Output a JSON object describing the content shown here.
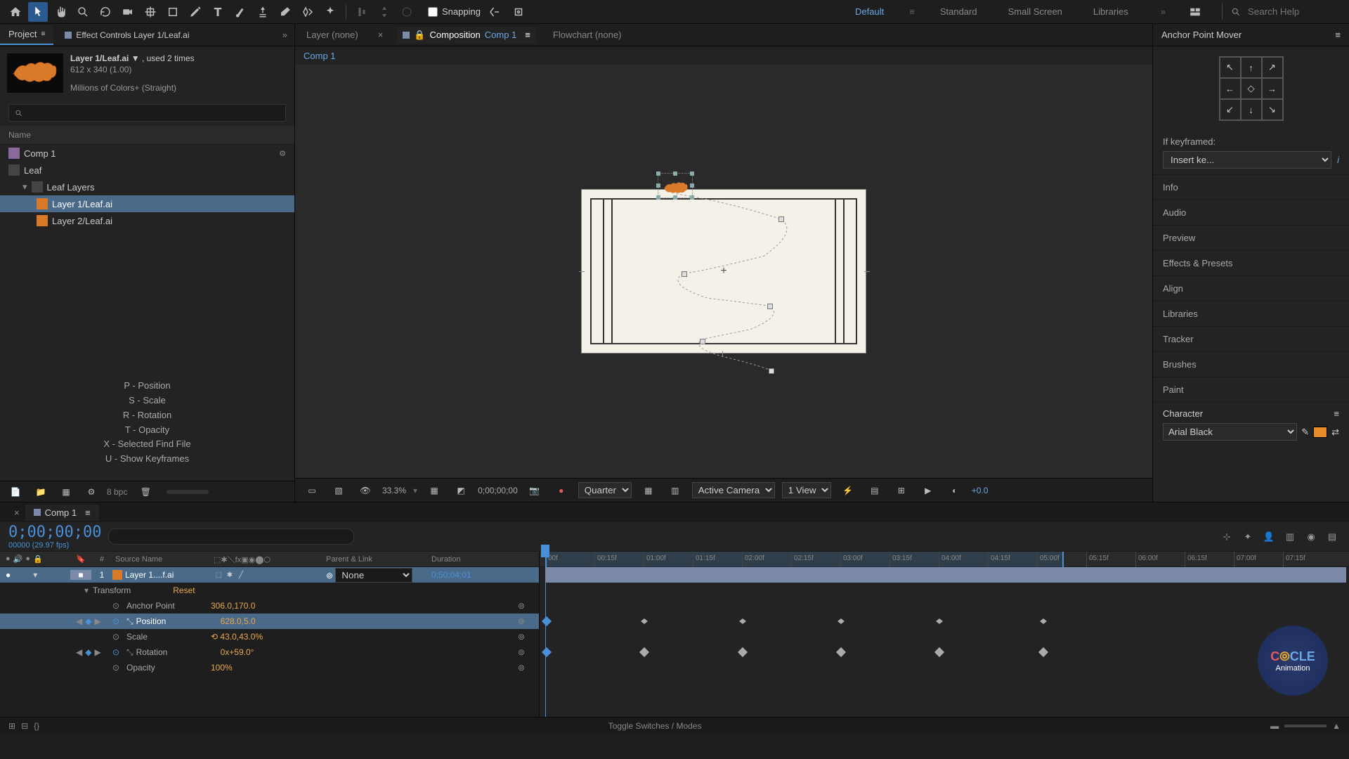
{
  "toolbar": {
    "snapping_label": "Snapping",
    "workspaces": [
      "Default",
      "Standard",
      "Small Screen",
      "Libraries"
    ],
    "active_workspace": "Default",
    "search_placeholder": "Search Help"
  },
  "project_panel": {
    "tab_project": "Project",
    "tab_effect_controls": "Effect Controls Layer 1/Leaf.ai",
    "selected_item": {
      "name": "Layer 1/Leaf.ai",
      "usage": ", used 2 times",
      "dimensions": "612 x 340 (1.00)",
      "colors": "Millions of Colors+ (Straight)"
    },
    "name_col": "Name",
    "items": {
      "comp": "Comp 1",
      "leaf": "Leaf",
      "folder": "Leaf Layers",
      "layer1": "Layer 1/Leaf.ai",
      "layer2": "Layer 2/Leaf.ai"
    },
    "hints": [
      "P - Position",
      "S - Scale",
      "R - Rotation",
      "T - Opacity",
      "X - Selected Find File",
      "U - Show Keyframes"
    ],
    "bpc": "8 bpc"
  },
  "comp_viewer": {
    "tab_layer": "Layer (none)",
    "tab_composition_prefix": "Composition ",
    "tab_composition_name": "Comp 1",
    "tab_flowchart": "Flowchart (none)",
    "breadcrumb": "Comp 1",
    "bottombar": {
      "zoom": "33.3%",
      "timecode": "0;00;00;00",
      "resolution": "Quarter",
      "camera": "Active Camera",
      "view": "1 View",
      "exposure": "+0.0"
    }
  },
  "right_panel": {
    "title": "Anchor Point Mover",
    "if_keyframed": "If keyframed:",
    "kf_option": "Insert ke...",
    "sections": [
      "Info",
      "Audio",
      "Preview",
      "Effects & Presets",
      "Align",
      "Libraries",
      "Tracker",
      "Brushes",
      "Paint"
    ],
    "character": "Character",
    "font": "Arial Black"
  },
  "timeline": {
    "tab": "Comp 1",
    "timecode": "0;00;00;00",
    "fps_hint": "00000 (29.97 fps)",
    "columns": {
      "source_name": "Source Name",
      "parent": "Parent & Link",
      "duration": "Duration"
    },
    "layer": {
      "num": "1",
      "name": "Layer 1....f.ai",
      "parent": "None",
      "duration": "0;50;04;01"
    },
    "transform_label": "Transform",
    "reset": "Reset",
    "props": {
      "anchor_point": {
        "name": "Anchor Point",
        "value": "306.0,170.0"
      },
      "position": {
        "name": "Position",
        "value": "628.0,5.0"
      },
      "scale": {
        "name": "Scale",
        "value": "43.0,43.0%"
      },
      "rotation": {
        "name": "Rotation",
        "value": "0x+59.0°"
      },
      "opacity": {
        "name": "Opacity",
        "value": "100%"
      }
    },
    "ruler": [
      "00f",
      "00:15f",
      "01:00f",
      "01:15f",
      "02:00f",
      "02:15f",
      "03:00f",
      "03:15f",
      "04:00f",
      "04:15f",
      "05:00f",
      "05:15f",
      "06:00f",
      "06:15f",
      "07:00f",
      "07:15f"
    ],
    "bottom_label": "Toggle Switches / Modes"
  },
  "watermark": {
    "line1": "C⊙CLE",
    "line2": "Animation"
  }
}
